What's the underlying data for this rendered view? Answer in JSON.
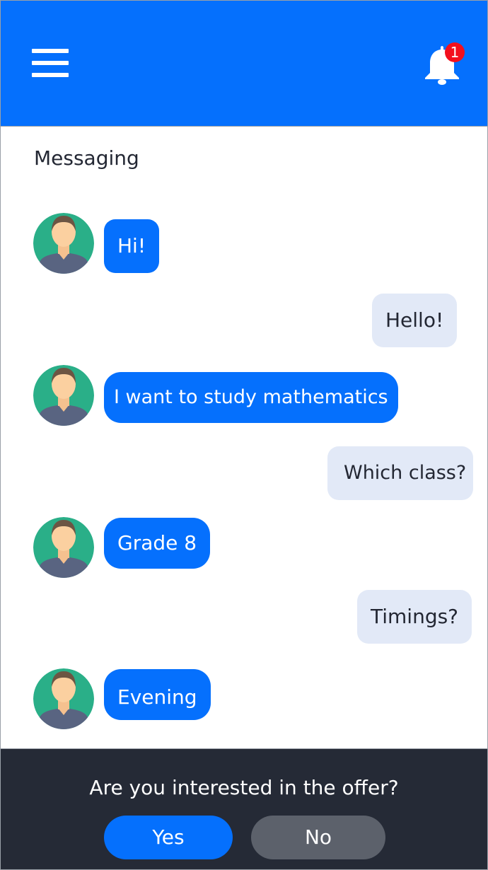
{
  "header": {
    "menu_icon": "hamburger-menu-icon",
    "bell_icon": "bell-icon",
    "notification_count": "1",
    "background_color": "#0570fd"
  },
  "page": {
    "title": "Messaging"
  },
  "messages": [
    {
      "sender": "other",
      "text": "Hi!"
    },
    {
      "sender": "me",
      "text": "Hello!"
    },
    {
      "sender": "other",
      "text": "I want to study mathematics"
    },
    {
      "sender": "me",
      "text": "Which class?"
    },
    {
      "sender": "other",
      "text": "Grade 8"
    },
    {
      "sender": "me",
      "text": "Timings?"
    },
    {
      "sender": "other",
      "text": "Evening"
    }
  ],
  "footer": {
    "prompt": "Are you interested in the offer?",
    "yes_label": "Yes",
    "no_label": "No"
  },
  "colors": {
    "incoming_bubble": "#0570fd",
    "outgoing_bubble": "#e2e9f7",
    "footer_background": "#252a36",
    "no_button": "#5c616b",
    "badge": "#f3101d"
  }
}
